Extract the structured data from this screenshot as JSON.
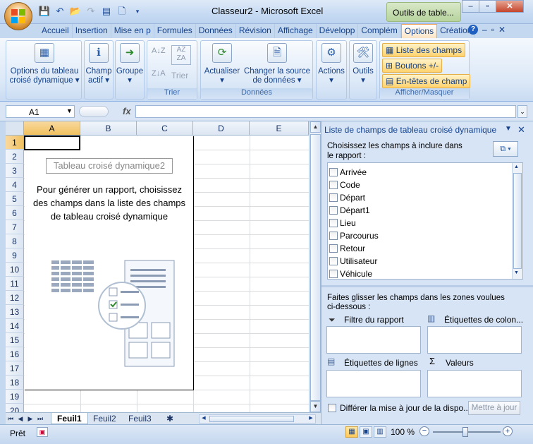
{
  "window": {
    "title": "Classeur2 - Microsoft Excel",
    "contextual_tab_group": "Outils de table...",
    "controls": [
      "–",
      "▫",
      "✕"
    ]
  },
  "ribbon": {
    "tabs": [
      "Accueil",
      "Insertion",
      "Mise en p",
      "Formules",
      "Données",
      "Révision",
      "Affichage",
      "Développ",
      "Complém",
      "Options",
      "Création"
    ],
    "active_tab": "Options",
    "groups": {
      "options": {
        "line1": "Options du tableau",
        "line2": "croisé dynamique ▾"
      },
      "champ": {
        "line1": "Champ",
        "line2": "actif ▾"
      },
      "groupe": {
        "line1": "Groupe",
        "line2": "▾"
      },
      "trier": {
        "label": "Trier",
        "button": "Trier"
      },
      "donnees": {
        "label": "Données",
        "actualiser": "Actualiser",
        "actualiser_arrow": "▾",
        "changer_line1": "Changer la source",
        "changer_line2": "de données ▾"
      },
      "actions": {
        "label": "Actions",
        "arrow": "▾"
      },
      "outils": {
        "label": "Outils",
        "arrow": "▾"
      },
      "afficher": {
        "label": "Afficher/Masquer",
        "liste": "Liste des champs",
        "boutons": "Boutons +/-",
        "entetes": "En-têtes de champ"
      }
    }
  },
  "formula_bar": {
    "cell": "A1",
    "fx": "fx",
    "value": ""
  },
  "sheet": {
    "columns": [
      "A",
      "B",
      "C",
      "D",
      "E"
    ],
    "rows": [
      "1",
      "2",
      "3",
      "4",
      "5",
      "6",
      "7",
      "8",
      "9",
      "10",
      "11",
      "12",
      "13",
      "14",
      "15",
      "16",
      "17",
      "18",
      "19",
      "20"
    ],
    "selected_cell": "A1",
    "pivot": {
      "title": "Tableau croisé dynamique2",
      "message": "Pour générer un rapport, choisissez des champs dans la liste des champs de tableau croisé dynamique"
    },
    "tabs": [
      "Feuil1",
      "Feuil2",
      "Feuil3"
    ],
    "active_tab": "Feuil1"
  },
  "field_pane": {
    "title": "Liste de champs de tableau croisé dynamique",
    "instruction": "Choisissez les champs à inclure dans le rapport :",
    "fields": [
      "Arrivée",
      "Code",
      "Départ",
      "Départ1",
      "Lieu",
      "Parcourus",
      "Retour",
      "Utilisateur",
      "Véhicule"
    ],
    "drag_instruction": "Faites glisser les champs dans les zones voulues ci-dessous :",
    "zones": {
      "filter": "Filtre du rapport",
      "columns": "Étiquettes de colon...",
      "rows": "Étiquettes de lignes",
      "values": "Valeurs"
    },
    "defer_label": "Différer la mise à jour de la dispo...",
    "update_button": "Mettre à jour"
  },
  "status_bar": {
    "ready": "Prêt",
    "zoom": "100 %"
  },
  "colors": {
    "accent_orange": "#ffd26e",
    "ribbon_text": "#15428b",
    "grid_header": "#dbe5f2"
  }
}
